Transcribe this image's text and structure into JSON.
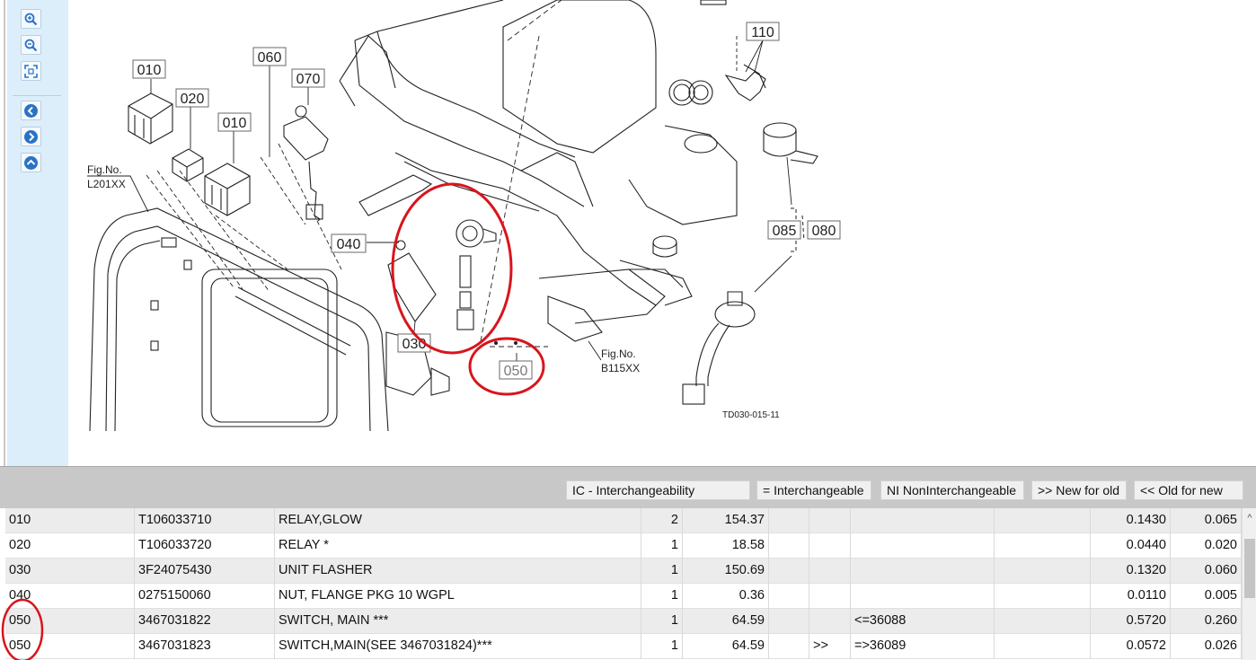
{
  "toolbar": {
    "buttons": [
      {
        "name": "zoom-in",
        "icon": "zoom-in-icon"
      },
      {
        "name": "zoom-out",
        "icon": "zoom-out-icon"
      },
      {
        "name": "fit",
        "icon": "fit-to-window-icon"
      },
      {
        "name": "previous",
        "icon": "arrow-left-icon"
      },
      {
        "name": "next",
        "icon": "arrow-right-icon"
      },
      {
        "name": "up",
        "icon": "arrow-up-icon"
      }
    ]
  },
  "diagram": {
    "callouts": {
      "c010a": "010",
      "c020": "020",
      "c010b": "010",
      "c060": "060",
      "c070": "070",
      "c040": "040",
      "c030": "030",
      "c050": "050",
      "c110": "110",
      "c085": "085",
      "c080": "080"
    },
    "fig_left": {
      "line1": "Fig.No.",
      "line2": "L201XX"
    },
    "fig_right": {
      "line1": "Fig.No.",
      "line2": "B115XX"
    },
    "drawing_id": "TD030-015-11",
    "highlight_color": "#d9141c"
  },
  "legend": {
    "ic": "IC - Interchangeability",
    "eq": "= Interchangeable",
    "ni": "NI NonInterchangeable",
    "new_for_old": ">> New for old",
    "old_for_new": "<< Old for new"
  },
  "parts": [
    {
      "ref": "010",
      "part_no": "T106033710",
      "desc": "RELAY,GLOW",
      "qty": "2",
      "price": "154.37",
      "ic": "",
      "serial": "",
      "w1": "0.1430",
      "w2": "0.065"
    },
    {
      "ref": "020",
      "part_no": "T106033720",
      "desc": "RELAY *",
      "qty": "1",
      "price": "18.58",
      "ic": "",
      "serial": "",
      "w1": "0.0440",
      "w2": "0.020"
    },
    {
      "ref": "030",
      "part_no": "3F24075430",
      "desc": "UNIT FLASHER",
      "qty": "1",
      "price": "150.69",
      "ic": "",
      "serial": "",
      "w1": "0.1320",
      "w2": "0.060"
    },
    {
      "ref": "040",
      "part_no": "0275150060",
      "desc": "NUT, FLANGE PKG 10 WGPL",
      "qty": "1",
      "price": "0.36",
      "ic": "",
      "serial": "",
      "w1": "0.0110",
      "w2": "0.005"
    },
    {
      "ref": "050",
      "part_no": "3467031822",
      "desc": "SWITCH, MAIN ***",
      "qty": "1",
      "price": "64.59",
      "ic": "",
      "serial": "<=36088",
      "w1": "0.5720",
      "w2": "0.260"
    },
    {
      "ref": "050",
      "part_no": "3467031823",
      "desc": "SWITCH,MAIN(SEE 3467031824)***",
      "qty": "1",
      "price": "64.59",
      "ic": ">>",
      "serial": "=>36089",
      "w1": "0.0572",
      "w2": "0.026"
    }
  ],
  "scrollbar": {
    "up_arrow": "^"
  }
}
